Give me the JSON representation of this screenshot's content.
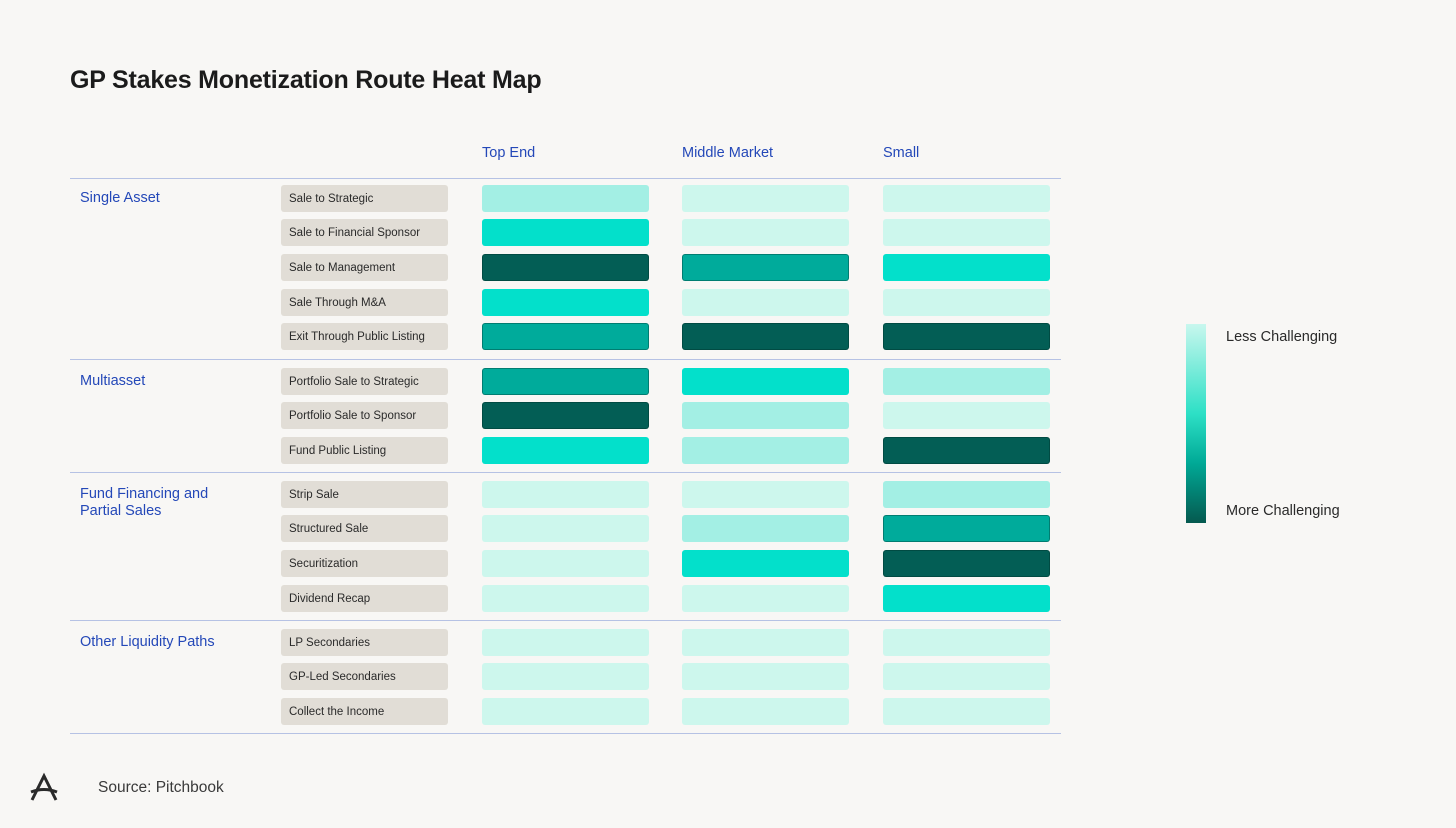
{
  "title": "GP Stakes Monetization Route Heat Map",
  "columns": [
    "Top End",
    "Middle Market",
    "Small"
  ],
  "legend": {
    "low": "Less Challenging",
    "high": "More Challenging"
  },
  "source": "Source: Pitchbook",
  "colors": {
    "1": "#cdf7ed",
    "2": "#a3efe4",
    "3": "#03e0cb",
    "4": "#00ab9b",
    "5": "#035e55"
  },
  "chart_data": {
    "type": "heatmap",
    "title": "GP Stakes Monetization Route Heat Map",
    "x": [
      "Top End",
      "Middle Market",
      "Small"
    ],
    "scale": {
      "min": 1,
      "max": 5,
      "low_label": "Less Challenging",
      "high_label": "More Challenging"
    },
    "groups": [
      {
        "name": "Single Asset",
        "rows": [
          {
            "label": "Sale to Strategic",
            "values": [
              2,
              1,
              1
            ]
          },
          {
            "label": "Sale to Financial Sponsor",
            "values": [
              3,
              1,
              1
            ]
          },
          {
            "label": "Sale to Management",
            "values": [
              5,
              4,
              3
            ]
          },
          {
            "label": "Sale Through M&A",
            "values": [
              3,
              1,
              1
            ]
          },
          {
            "label": "Exit Through Public Listing",
            "values": [
              4,
              5,
              5
            ]
          }
        ]
      },
      {
        "name": "Multiasset",
        "rows": [
          {
            "label": "Portfolio Sale to Strategic",
            "values": [
              4,
              3,
              2
            ]
          },
          {
            "label": "Portfolio Sale to Sponsor",
            "values": [
              5,
              2,
              1
            ]
          },
          {
            "label": "Fund Public Listing",
            "values": [
              3,
              2,
              5
            ]
          }
        ]
      },
      {
        "name": "Fund Financing and\nPartial Sales",
        "rows": [
          {
            "label": "Strip Sale",
            "values": [
              1,
              1,
              2
            ]
          },
          {
            "label": "Structured Sale",
            "values": [
              1,
              2,
              4
            ]
          },
          {
            "label": "Securitization",
            "values": [
              1,
              3,
              5
            ]
          },
          {
            "label": "Dividend Recap",
            "values": [
              1,
              1,
              3
            ]
          }
        ]
      },
      {
        "name": "Other Liquidity Paths",
        "rows": [
          {
            "label": "LP Secondaries",
            "values": [
              1,
              1,
              1
            ]
          },
          {
            "label": "GP-Led Secondaries",
            "values": [
              1,
              1,
              1
            ]
          },
          {
            "label": "Collect the Income",
            "values": [
              1,
              1,
              1
            ]
          }
        ]
      }
    ]
  }
}
